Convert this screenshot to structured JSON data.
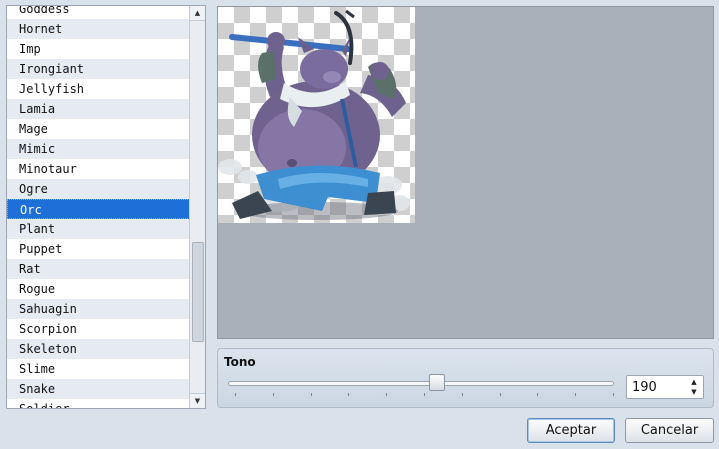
{
  "list": {
    "items": [
      {
        "label": "Goddess"
      },
      {
        "label": "Hornet"
      },
      {
        "label": "Imp"
      },
      {
        "label": "Irongiant"
      },
      {
        "label": "Jellyfish"
      },
      {
        "label": "Lamia"
      },
      {
        "label": "Mage"
      },
      {
        "label": "Mimic"
      },
      {
        "label": "Minotaur"
      },
      {
        "label": "Ogre"
      },
      {
        "label": "Orc"
      },
      {
        "label": "Plant"
      },
      {
        "label": "Puppet"
      },
      {
        "label": "Rat"
      },
      {
        "label": "Rogue"
      },
      {
        "label": "Sahuagin"
      },
      {
        "label": "Scorpion"
      },
      {
        "label": "Skeleton"
      },
      {
        "label": "Slime"
      },
      {
        "label": "Snake"
      },
      {
        "label": "Soldier"
      }
    ],
    "selected_label": "Orc",
    "scroll_up_icon": "triangle-up",
    "scroll_down_icon": "triangle-down"
  },
  "preview": {
    "sprite": "orc-with-pickaxe"
  },
  "tone": {
    "label": "Tono",
    "value": "190",
    "slider_fraction": 0.53,
    "tick_count": 11
  },
  "buttons": {
    "ok_label": "Aceptar",
    "cancel_label": "Cancelar"
  },
  "colors": {
    "selection": "#1f6fd8",
    "alt_row": "#e6ebf1",
    "preview_bg": "#a9b0b9"
  }
}
